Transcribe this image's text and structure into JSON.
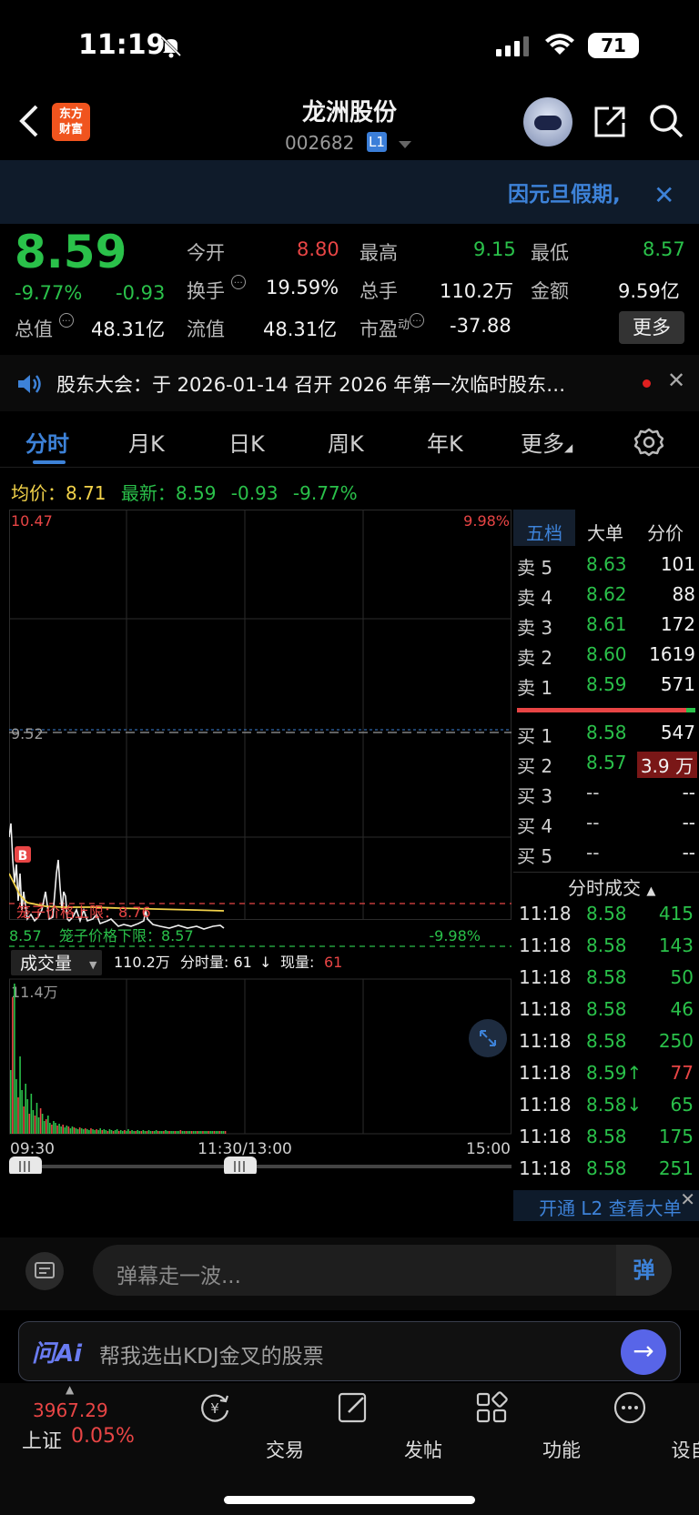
{
  "status": {
    "time": "11:19",
    "battery": "71"
  },
  "header": {
    "logo": "东方\n财富",
    "title": "龙洲股份",
    "code": "002682",
    "level": "L1"
  },
  "banner": {
    "text": "因元旦假期,"
  },
  "quote": {
    "price": "8.59",
    "pct": "-9.77%",
    "chg": "-0.93",
    "open_label": "今开",
    "open": "8.80",
    "high_label": "最高",
    "high": "9.15",
    "low_label": "最低",
    "low": "8.57",
    "turnover_label": "换手",
    "turnover": "19.59%",
    "vol_label": "总手",
    "vol": "110.2万",
    "amount_label": "金额",
    "amount": "9.59亿",
    "mcap_label": "总值",
    "mcap": "48.31亿",
    "float_label": "流值",
    "float": "48.31亿",
    "pe_label": "市盈",
    "pe_sup": "动",
    "pe": "-37.88",
    "more": "更多"
  },
  "notice": {
    "text": "股东大会：于 2026-01-14 召开 2026 年第一次临时股东…"
  },
  "tabs": [
    "分时",
    "月K",
    "日K",
    "周K",
    "年K",
    "更多"
  ],
  "avgline": {
    "avg_label": "均价：",
    "avg": "8.71",
    "last_label": "最新：",
    "last": "8.59",
    "chg": "-0.93",
    "pct": "-9.77%"
  },
  "chart": {
    "y_top": "10.47",
    "pct_top": "9.98%",
    "y_mid": "9.52",
    "y_bottom": "8.57",
    "pct_bottom": "-9.98%",
    "upper_limit_label": "笼子价格上限：8.76",
    "lower_limit_label": "笼子价格下限：8.57",
    "marker": "B",
    "vol_selector": "成交量",
    "vol_total": "110.2万",
    "vol_minute_label": "分时量: 61",
    "vol_now_label": "现量:",
    "vol_now": "61",
    "vol_max": "11.4万",
    "time_start": "09:30",
    "time_mid": "11:30/13:00",
    "time_end": "15:00"
  },
  "book": {
    "tabs": [
      "五档",
      "大单",
      "分价"
    ],
    "asks": [
      {
        "label": "卖 5",
        "price": "8.63",
        "vol": "101"
      },
      {
        "label": "卖 4",
        "price": "8.62",
        "vol": "88"
      },
      {
        "label": "卖 3",
        "price": "8.61",
        "vol": "172"
      },
      {
        "label": "卖 2",
        "price": "8.60",
        "vol": "1619"
      },
      {
        "label": "卖 1",
        "price": "8.59",
        "vol": "571"
      }
    ],
    "bids": [
      {
        "label": "买 1",
        "price": "8.58",
        "vol": "547"
      },
      {
        "label": "买 2",
        "price": "8.57",
        "vol": "3.9 万"
      },
      {
        "label": "买 3",
        "price": "--",
        "vol": "--"
      },
      {
        "label": "买 4",
        "price": "--",
        "vol": "--"
      },
      {
        "label": "买 5",
        "price": "--",
        "vol": "--"
      }
    ],
    "trades_title": "分时成交",
    "trades": [
      {
        "time": "11:18",
        "price": "8.58",
        "vol": "415"
      },
      {
        "time": "11:18",
        "price": "8.58",
        "vol": "143"
      },
      {
        "time": "11:18",
        "price": "8.58",
        "vol": "50"
      },
      {
        "time": "11:18",
        "price": "8.58",
        "vol": "46"
      },
      {
        "time": "11:18",
        "price": "8.58",
        "vol": "250"
      },
      {
        "time": "11:18",
        "price": "8.59↑",
        "vol": "77"
      },
      {
        "time": "11:18",
        "price": "8.58↓",
        "vol": "65"
      },
      {
        "time": "11:18",
        "price": "8.58",
        "vol": "175"
      },
      {
        "time": "11:18",
        "price": "8.58",
        "vol": "251"
      }
    ],
    "l2": "开通 L2 查看大单"
  },
  "danmu": {
    "placeholder": "弹幕走一波...",
    "btn": "弹"
  },
  "ai": {
    "brand": "问Ai",
    "prompt": "帮我选出KDJ金叉的股票"
  },
  "nav": {
    "index_value": "3967.29",
    "index_name": "上证",
    "index_pct": "0.05%",
    "items": [
      "交易",
      "发帖",
      "功能",
      "设自选"
    ]
  },
  "colors": {
    "up": "#e84545",
    "down": "#2ac14a",
    "accent": "#3d82d8",
    "avg": "#f3d34a"
  }
}
